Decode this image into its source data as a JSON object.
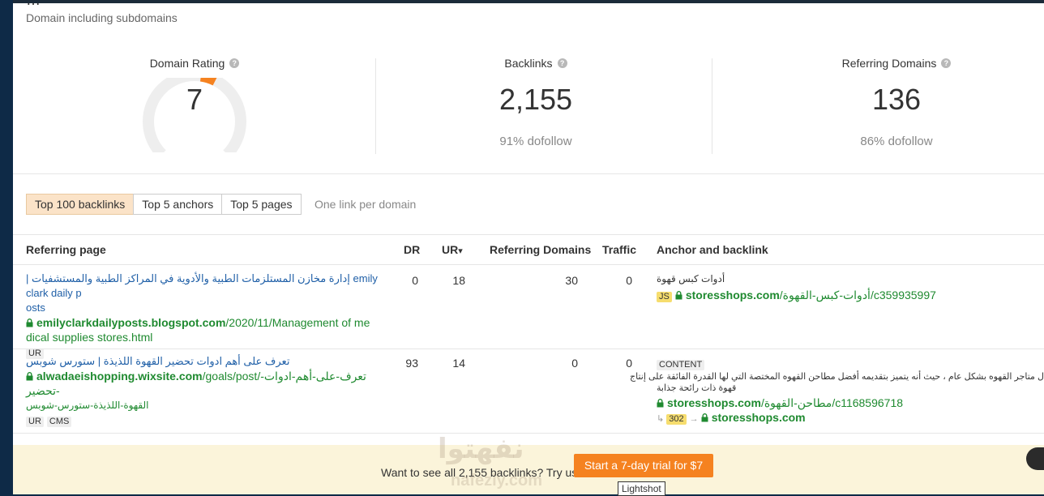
{
  "header": {
    "cut_title": "…",
    "subtitle": "Domain including subdomains"
  },
  "metrics": {
    "domain_rating": {
      "label": "Domain Rating",
      "value": "7",
      "gauge_fraction": 0.07
    },
    "backlinks": {
      "label": "Backlinks",
      "value": "2,155",
      "sub": "91% dofollow"
    },
    "referring_domains": {
      "label": "Referring Domains",
      "value": "136",
      "sub": "86% dofollow"
    }
  },
  "tabs": {
    "items": [
      "Top 100 backlinks",
      "Top 5 anchors",
      "Top 5 pages"
    ],
    "note": "One link per domain"
  },
  "table": {
    "headers": {
      "referring_page": "Referring page",
      "dr": "DR",
      "ur": "UR",
      "ur_sort": "▾",
      "referring_domains": "Referring Domains",
      "traffic": "Traffic",
      "anchor": "Anchor and backlink"
    },
    "rows": [
      {
        "title_ar": "إدارة مخازن المستلزمات الطبية والأدوية في المراكز الطبية والمستشفيات |",
        "title_en": "emily clark daily p",
        "title_en2": "osts",
        "url_domain": "emilyclarkdailyposts.blogspot.com",
        "url_path": "/2020/11/Management of me",
        "url_path2": "dical supplies stores.html",
        "badges": [
          "UR"
        ],
        "dr": "0",
        "ur": "18",
        "ref_domains": "30",
        "traffic": "0",
        "anchor_text": "أدوات كبس قهوة",
        "anchor_badge": "JS",
        "anchor_domain": "storesshops.com",
        "anchor_path": "/أدوات-كبس-القهوة/c359935997"
      },
      {
        "title": "تعرف على أهم ادوات تحضير القهوة اللذيذة | ستورس شوبس",
        "url_domain": "alwadaeishopping.wixsite.com",
        "url_path": "/goals/post/تعرف-على-أهم-ادوات-تحضير-",
        "url_path2": "القهوة-اللذيذة-ستورس-شوبس",
        "badges": [
          "UR",
          "CMS"
        ],
        "dr": "93",
        "ur": "14",
        "ref_domains": "0",
        "traffic": "0",
        "anchor_badge": "CONTENT",
        "anchor_context": "ل متاجر القهوه بشكل عام ، حيث أنه يتميز بتقديمه أفضل مطاحن القهوه المختصة التي لها القدرة الفائقة على إنتاج",
        "anchor_context2": "قهوة ذات رائحة جذابة",
        "anchor_domain": "storesshops.com",
        "anchor_path": "/مطاحن-القهوة/c1168596718",
        "redirect_code": "302",
        "redirect_domain": "storesshops.com"
      }
    ]
  },
  "banner": {
    "text": "Want to see all 2,155 backlinks? Try us.",
    "cta": "Start a 7-day trial for $7"
  },
  "watermark": {
    "text": "نفهتوا",
    "text2": "nafeziy.com"
  },
  "tooltip": "Lightshot",
  "colors": {
    "accent": "#f58220",
    "gauge_fill": "#f58220",
    "gauge_track": "#eeeeee",
    "link": "#1f5fa7",
    "url_green": "#1f8a30",
    "tab_active": "#fbe3c8",
    "banner_bg": "#fbf4da"
  }
}
